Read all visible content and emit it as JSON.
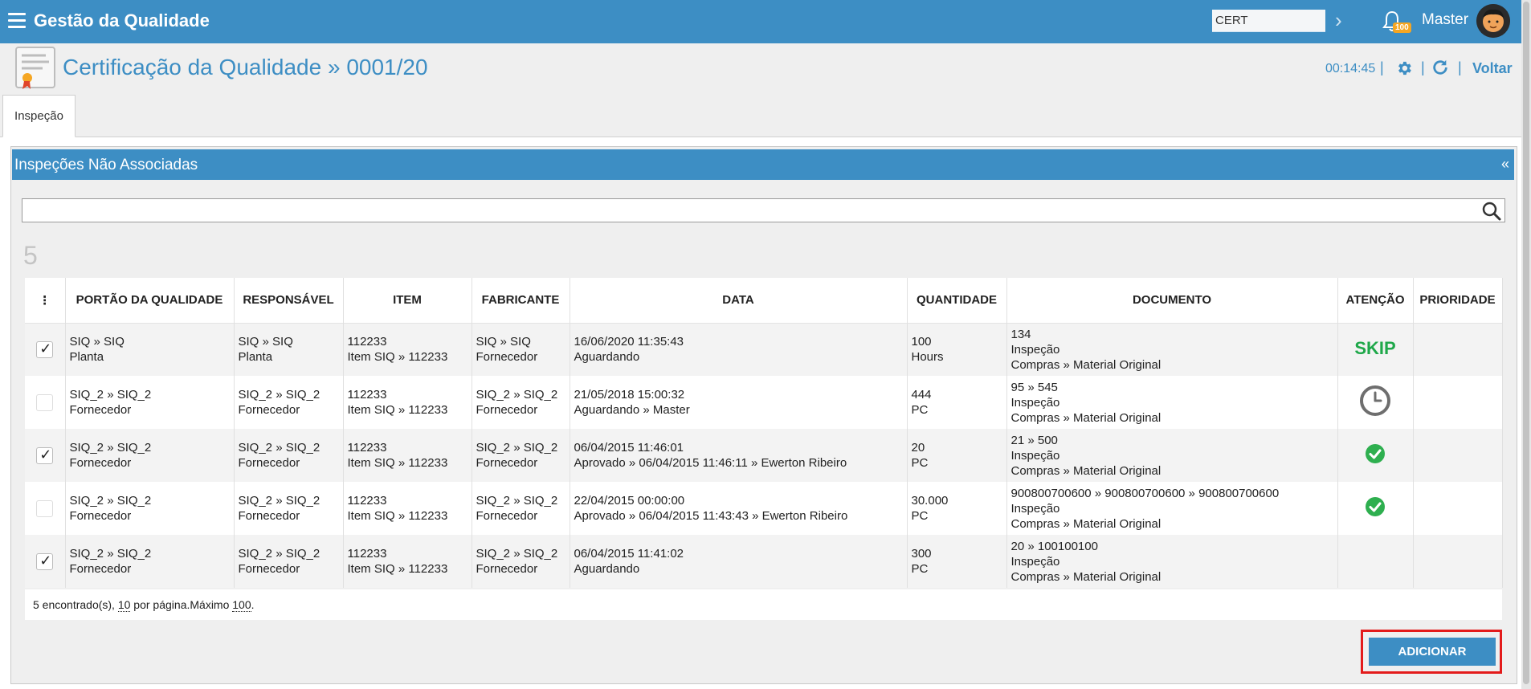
{
  "topbar": {
    "app_title": "Gestão da Qualidade",
    "env_value": "CERT",
    "notification_count": "100",
    "username": "Master"
  },
  "header": {
    "title": "Certificação da Qualidade » 0001/20",
    "timer": "00:14:45",
    "back_label": "Voltar"
  },
  "tabs": [
    {
      "label": "Inspeção"
    }
  ],
  "panel": {
    "title": "Inspeções Não Associadas",
    "collapse": "«",
    "count": "5"
  },
  "table": {
    "menu_glyph": "⋮",
    "columns": [
      "PORTÃO DA QUALIDADE",
      "RESPONSÁVEL",
      "ITEM",
      "FABRICANTE",
      "DATA",
      "QUANTIDADE",
      "DOCUMENTO",
      "ATENÇÃO",
      "PRIORIDADE"
    ],
    "rows": [
      {
        "checked": true,
        "gate": [
          "SIQ » SIQ",
          "Planta"
        ],
        "resp": [
          "SIQ » SIQ",
          "Planta"
        ],
        "item": [
          "112233",
          "Item SIQ » 112233"
        ],
        "maker": [
          "SIQ » SIQ",
          "Fornecedor"
        ],
        "date": [
          "16/06/2020 11:35:43",
          "Aguardando"
        ],
        "qty": [
          "100",
          "Hours"
        ],
        "doc": [
          "134",
          "Inspeção",
          "Compras » Material Original"
        ],
        "attention": "skip",
        "attention_text": "SKIP"
      },
      {
        "checked": false,
        "gate": [
          "SIQ_2 » SIQ_2",
          "Fornecedor"
        ],
        "resp": [
          "SIQ_2 » SIQ_2",
          "Fornecedor"
        ],
        "item": [
          "112233",
          "Item SIQ » 112233"
        ],
        "maker": [
          "SIQ_2 » SIQ_2",
          "Fornecedor"
        ],
        "date": [
          "21/05/2018 15:00:32",
          "Aguardando » Master"
        ],
        "qty": [
          "444",
          "PC"
        ],
        "doc": [
          "95 » 545",
          "Inspeção",
          "Compras » Material Original"
        ],
        "attention": "clock-icon"
      },
      {
        "checked": true,
        "gate": [
          "SIQ_2 » SIQ_2",
          "Fornecedor"
        ],
        "resp": [
          "SIQ_2 » SIQ_2",
          "Fornecedor"
        ],
        "item": [
          "112233",
          "Item SIQ » 112233"
        ],
        "maker": [
          "SIQ_2 » SIQ_2",
          "Fornecedor"
        ],
        "date": [
          "06/04/2015 11:46:01",
          "Aprovado » 06/04/2015 11:46:11 » Ewerton Ribeiro"
        ],
        "qty": [
          "20",
          "PC"
        ],
        "doc": [
          "21 » 500",
          "Inspeção",
          "Compras » Material Original"
        ],
        "attention": "check-circle-icon"
      },
      {
        "checked": false,
        "gate": [
          "SIQ_2 » SIQ_2",
          "Fornecedor"
        ],
        "resp": [
          "SIQ_2 » SIQ_2",
          "Fornecedor"
        ],
        "item": [
          "112233",
          "Item SIQ » 112233"
        ],
        "maker": [
          "SIQ_2 » SIQ_2",
          "Fornecedor"
        ],
        "date": [
          "22/04/2015 00:00:00",
          "Aprovado » 06/04/2015 11:43:43 » Ewerton Ribeiro"
        ],
        "qty": [
          "30.000",
          "PC"
        ],
        "doc": [
          "900800700600 » 900800700600 » 900800700600",
          "Inspeção",
          "Compras » Material Original"
        ],
        "attention": "check-circle-icon"
      },
      {
        "checked": true,
        "gate": [
          "SIQ_2 » SIQ_2",
          "Fornecedor"
        ],
        "resp": [
          "SIQ_2 » SIQ_2",
          "Fornecedor"
        ],
        "item": [
          "112233",
          "Item SIQ » 112233"
        ],
        "maker": [
          "SIQ_2 » SIQ_2",
          "Fornecedor"
        ],
        "date": [
          "06/04/2015 11:41:02",
          "Aguardando"
        ],
        "qty": [
          "300",
          "PC"
        ],
        "doc": [
          "20 » 100100100",
          "Inspeção",
          "Compras » Material Original"
        ],
        "attention": ""
      }
    ]
  },
  "footer": {
    "found_text": "5 encontrado(s), ",
    "per_page": "10",
    "per_page_text": " por página.Máximo ",
    "max": "100",
    "end": "."
  },
  "actions": {
    "add_label": "ADICIONAR"
  },
  "colors": {
    "primary": "#3d8ec4",
    "success": "#2eaf4f",
    "skip": "#1fa84a",
    "highlight": "#e31b1b"
  }
}
